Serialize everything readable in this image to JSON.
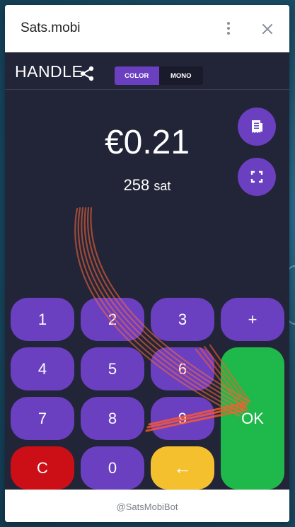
{
  "window": {
    "title": "Sats.mobi",
    "footer": "@SatsMobiBot"
  },
  "header": {
    "handle": "HANDLE",
    "modes": [
      {
        "label": "COLOR",
        "active": true
      },
      {
        "label": "MONO",
        "active": false
      }
    ]
  },
  "display": {
    "amount": "€0.21",
    "sats_value": "258",
    "sats_unit": "sat"
  },
  "icons": {
    "menu": "more-vertical-icon",
    "close": "close-icon",
    "share": "share-icon",
    "receipt": "receipt-icon",
    "fullscreen": "fullscreen-icon"
  },
  "keypad": {
    "k1": "1",
    "k2": "2",
    "k3": "3",
    "plus": "+",
    "k4": "4",
    "k5": "5",
    "k6": "6",
    "k7": "7",
    "k8": "8",
    "k9": "9",
    "clear": "C",
    "k0": "0",
    "back": "←",
    "ok": "OK"
  },
  "colors": {
    "app_bg": "#222437",
    "accent": "#6a3fc0",
    "clear": "#cc0f16",
    "back": "#f4c02e",
    "ok": "#1fb84b"
  }
}
